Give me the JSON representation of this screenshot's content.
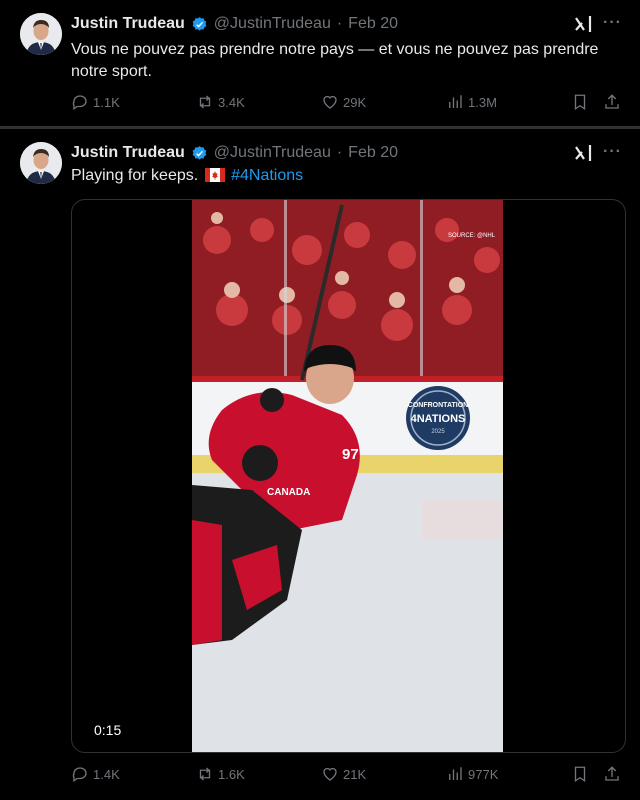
{
  "tweets": [
    {
      "author": {
        "name": "Justin Trudeau",
        "handle": "@JustinTrudeau",
        "separator": "·",
        "date": "Feb 20"
      },
      "text": "Vous ne pouvez pas prendre notre pays — et vous ne pouvez pas prendre notre sport.",
      "stats": {
        "replies": "1.1K",
        "reposts": "3.4K",
        "likes": "29K",
        "views": "1.3M"
      }
    },
    {
      "author": {
        "name": "Justin Trudeau",
        "handle": "@JustinTrudeau",
        "separator": "·",
        "date": "Feb 20"
      },
      "text": "Playing for keeps.",
      "hashtag": "#4Nations",
      "media": {
        "duration": "0:15",
        "watermark": "SOURCE: @NHL",
        "board_text_line1": "CONFRONTATION",
        "board_text_line2": "4NATIONS",
        "board_text_line3": "2025",
        "jersey_number": "97",
        "jersey_text": "CANADA"
      },
      "stats": {
        "replies": "1.4K",
        "reposts": "1.6K",
        "likes": "21K",
        "views": "977K"
      }
    }
  ],
  "colors": {
    "background": "#000000",
    "text": "#e7e9ea",
    "muted": "#71767b",
    "link": "#1d9bf0",
    "verified": "#1d9bf0"
  },
  "icons": [
    "verified-badge-icon",
    "grok-icon",
    "more-icon",
    "reply-icon",
    "repost-icon",
    "like-icon",
    "views-icon",
    "bookmark-icon",
    "share-icon",
    "canada-flag-icon"
  ]
}
